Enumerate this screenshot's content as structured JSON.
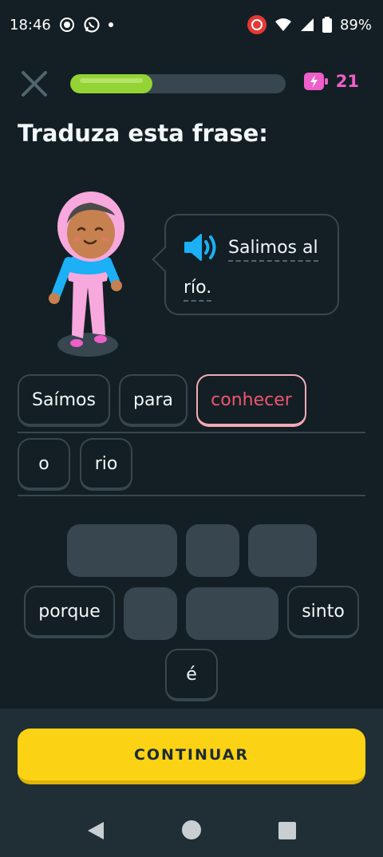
{
  "status_bar": {
    "time": "18:46",
    "battery": "89%"
  },
  "progress": {
    "value": 0.38
  },
  "energy": {
    "count": "21"
  },
  "title": "Traduza esta frase:",
  "bubble": {
    "word1": "Salimos al",
    "word2": "río."
  },
  "answer_chips": [
    {
      "label": "Saímos",
      "selected": false
    },
    {
      "label": "para",
      "selected": false
    },
    {
      "label": "conhecer",
      "selected": true
    },
    {
      "label": "o",
      "selected": false
    },
    {
      "label": "rio",
      "selected": false
    }
  ],
  "bank_chips": [
    {
      "label": "porque"
    },
    {
      "label": "sinto"
    },
    {
      "label": "é"
    }
  ],
  "continue_label": "CONTINUAR",
  "colors": {
    "accent_green": "#93d333",
    "continue_yellow": "#fcd215",
    "energy_pink": "#ee5fc9",
    "selected_red": "#ee5570"
  }
}
